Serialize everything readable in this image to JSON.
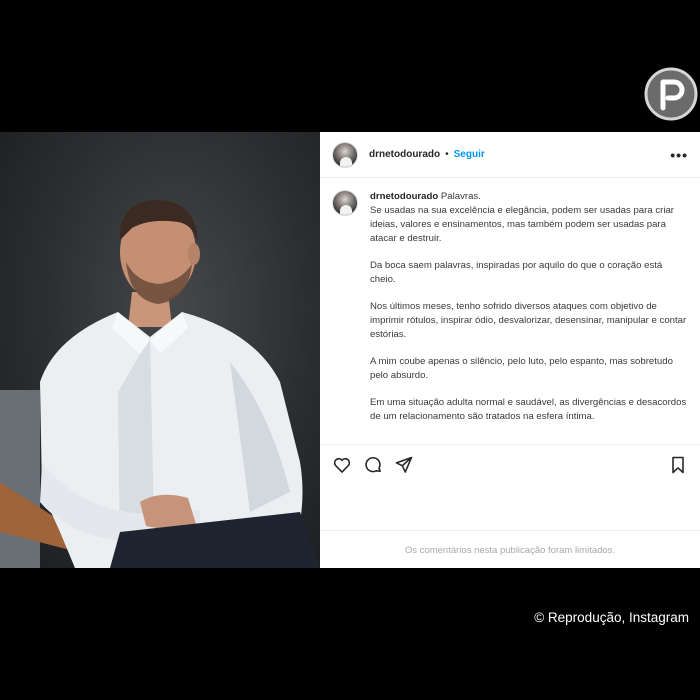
{
  "watermark": {
    "icon": "purepeople-p-logo"
  },
  "post": {
    "header": {
      "username": "drnetodourado",
      "separator": "•",
      "follow_label": "Seguir",
      "more_icon": "more-horizontal-icon",
      "more_label": "•••"
    },
    "caption": {
      "username": "drnetodourado",
      "first_line": "Palavras.",
      "paragraph_1_rest": "Se usadas na sua excelência e elegância, podem ser usadas para criar ideias, valores e ensinamentos, mas também podem ser usadas para atacar e destruir.",
      "paragraph_2": "Da boca saem palavras, inspiradas por aquilo do que o coração está cheio.",
      "paragraph_3": "Nos últimos meses, tenho sofrido diversos ataques com objetivo de imprimir rótulos, inspirar ódio, desvalorizar, desensinar, manipular e contar estórias.",
      "paragraph_4": "A mim coube apenas o silêncio, pelo luto, pelo espanto, mas sobretudo pelo absurdo.",
      "paragraph_5": "Em uma situação adulta normal e saudável, as divergências e desacordos de um relacionamento são tratados na esfera íntima."
    },
    "actions": {
      "like_icon": "heart-icon",
      "comment_icon": "comment-icon",
      "share_icon": "send-icon",
      "save_icon": "bookmark-icon"
    },
    "comments_limited_text": "Os comentários nesta publicação foram limitados."
  },
  "credit": "© Reprodução, Instagram",
  "colors": {
    "background": "#000000",
    "link_blue": "#0095f6",
    "text": "#262626",
    "muted": "#a8a8a8"
  }
}
